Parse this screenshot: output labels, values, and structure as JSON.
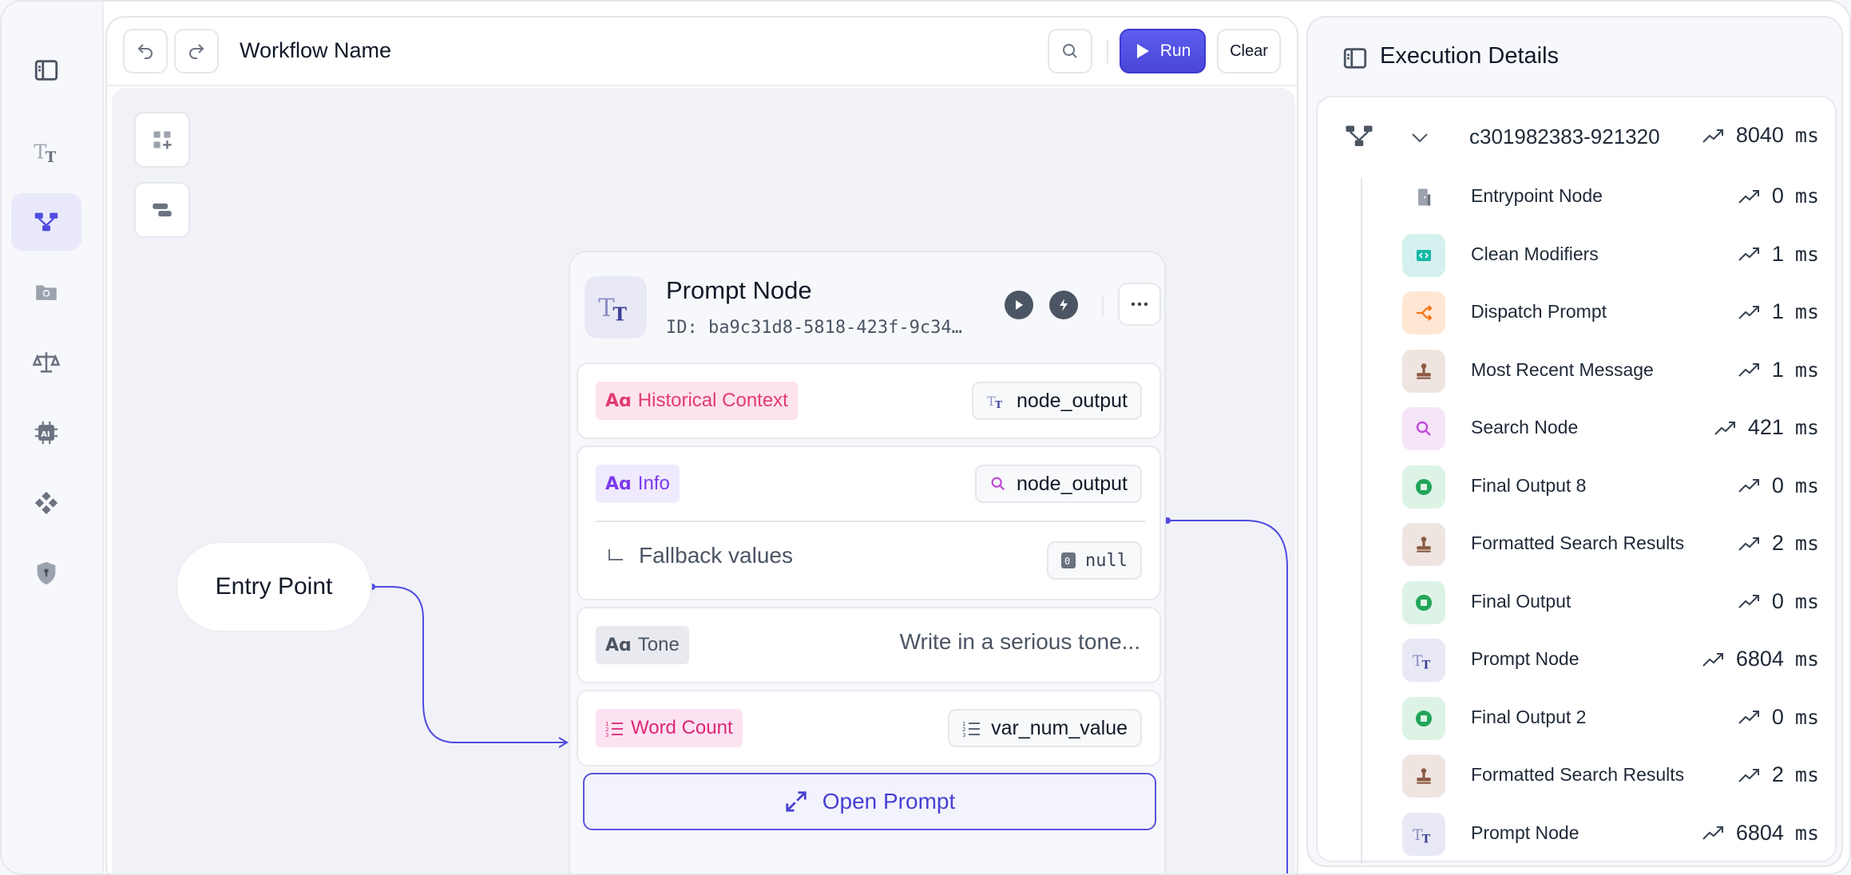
{
  "toolbar": {
    "workflow_name": "Workflow Name",
    "run_label": "Run",
    "clear_label": "Clear"
  },
  "canvas": {
    "entry_label": "Entry Point"
  },
  "prompt_node": {
    "title": "Prompt Node",
    "id": "ID: ba9c31d8-5818-423f-9c34…",
    "fields": [
      {
        "label": "Historical Context",
        "value": "node_output"
      },
      {
        "label": "Info",
        "value": "node_output",
        "fallback_label": "Fallback values",
        "fallback_value": "null"
      },
      {
        "label": "Tone",
        "value": "Write in a serious tone..."
      },
      {
        "label": "Word Count",
        "value": "var_num_value"
      }
    ],
    "open_prompt_label": "Open Prompt"
  },
  "execution": {
    "title": "Execution Details",
    "root": {
      "id": "c301982383-921320",
      "time": "8040",
      "unit": "ms"
    },
    "items": [
      {
        "label": "Entrypoint Node",
        "time": "0",
        "unit": "ms",
        "icon": "door-icon"
      },
      {
        "label": "Clean Modifiers",
        "time": "1",
        "unit": "ms",
        "icon": "code-icon"
      },
      {
        "label": "Dispatch Prompt",
        "time": "1",
        "unit": "ms",
        "icon": "split-icon"
      },
      {
        "label": "Most Recent Message",
        "time": "1",
        "unit": "ms",
        "icon": "stamp-icon"
      },
      {
        "label": "Search Node",
        "time": "421",
        "unit": "ms",
        "icon": "search-icon"
      },
      {
        "label": "Final Output 8",
        "time": "0",
        "unit": "ms",
        "icon": "stop-icon"
      },
      {
        "label": "Formatted Search Results",
        "time": "2",
        "unit": "ms",
        "icon": "stamp-icon"
      },
      {
        "label": "Final Output",
        "time": "0",
        "unit": "ms",
        "icon": "stop-icon"
      },
      {
        "label": "Prompt Node",
        "time": "6804",
        "unit": "ms",
        "icon": "text-icon"
      },
      {
        "label": "Final Output 2",
        "time": "0",
        "unit": "ms",
        "icon": "stop-icon"
      },
      {
        "label": "Formatted Search Results",
        "time": "2",
        "unit": "ms",
        "icon": "stamp-icon"
      },
      {
        "label": "Prompt Node",
        "time": "6804",
        "unit": "ms",
        "icon": "text-icon"
      }
    ]
  },
  "colors": {
    "accent": "#4f4ce0",
    "pink": "#e23b73",
    "purple": "#7c3aed",
    "magenta": "#db2777"
  }
}
